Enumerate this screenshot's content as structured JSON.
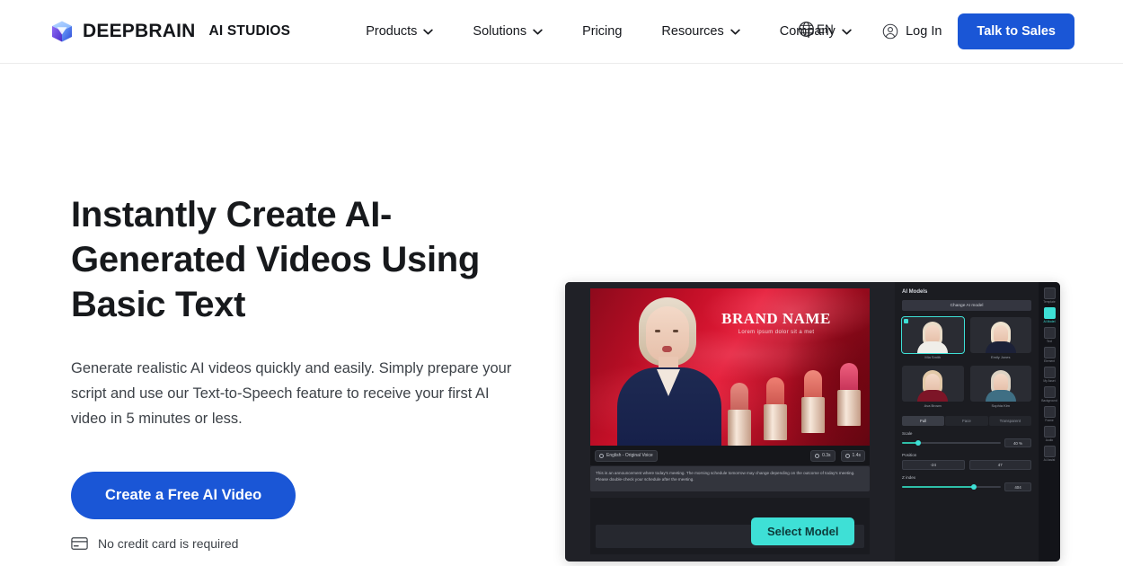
{
  "header": {
    "brand": {
      "name": "DEEPBRAIN",
      "sub": "AI STUDIOS",
      "logo_icon": "cube-icon"
    },
    "nav": [
      {
        "label": "Products",
        "has_dropdown": true
      },
      {
        "label": "Solutions",
        "has_dropdown": true
      },
      {
        "label": "Pricing",
        "has_dropdown": false
      },
      {
        "label": "Resources",
        "has_dropdown": true
      },
      {
        "label": "Company",
        "has_dropdown": true
      }
    ],
    "language": {
      "label": "EN",
      "icon": "globe-icon"
    },
    "login": {
      "label": "Log In",
      "icon": "user-circle-icon"
    },
    "cta": {
      "label": "Talk to Sales"
    }
  },
  "hero": {
    "title": "Instantly Create AI-Generated Videos Using Basic Text",
    "subtitle": "Generate realistic AI videos quickly and easily. Simply prepare your script and use our Text-to-Speech feature to receive your first AI video in 5 minutes or less.",
    "cta_label": "Create a Free AI Video",
    "note": "No credit card is required",
    "note_icon": "credit-card-icon",
    "accent_color": "#1a56d6"
  },
  "editor": {
    "stage": {
      "brand_name": "BRAND NAME",
      "brand_tagline": "Lorem ipsum dolor sit a met"
    },
    "toolbar": {
      "voice_pill": "English - Original Voice",
      "duration_pills": [
        "0.3s",
        "1.4s"
      ]
    },
    "script_text": "This is an announcement where today's meeting. The morning schedule tomorrow may change depending on the outcome of today's meeting. Please double-check your schedule after the meeting.",
    "overlay_button": "Select Model",
    "accent_color": "#3ee0d6",
    "panel": {
      "title": "AI Models",
      "change_button": "Change AI model",
      "models": [
        {
          "name": "Mia Smith",
          "selected": true,
          "hair": "#e9dcc8",
          "body": "#f0eee9"
        },
        {
          "name": "Emily Jones",
          "selected": false,
          "hair": "#efe3cf",
          "body": "#1c2138"
        },
        {
          "name": "Ava Brown",
          "selected": false,
          "hair": "#e2c9a8",
          "body": "#7d1527"
        },
        {
          "name": "Sophia Kim",
          "selected": false,
          "hair": "#ddd3c4",
          "body": "#3f6f84"
        }
      ],
      "tabs": [
        {
          "label": "Full",
          "active": true
        },
        {
          "label": "Face",
          "active": false
        },
        {
          "label": "Transparent",
          "active": false
        }
      ],
      "controls": [
        {
          "label": "Scale",
          "value": "40 %",
          "fill_pct": 16
        },
        {
          "label": "Z index",
          "value": "404",
          "fill_pct": 72
        }
      ],
      "position": {
        "label": "Position",
        "x": "-24",
        "y": "47"
      }
    },
    "rail": [
      {
        "label": "Template",
        "icon": "template-icon",
        "active": false
      },
      {
        "label": "AI Model",
        "icon": "ai-model-icon",
        "active": true
      },
      {
        "label": "Text",
        "icon": "text-icon",
        "active": false
      },
      {
        "label": "Element",
        "icon": "element-icon",
        "active": false
      },
      {
        "label": "My Asset",
        "icon": "my-asset-icon",
        "active": false
      },
      {
        "label": "Background",
        "icon": "background-icon",
        "active": false
      },
      {
        "label": "Frame",
        "icon": "frame-icon",
        "active": false
      },
      {
        "label": "Audio",
        "icon": "audio-icon",
        "active": false
      },
      {
        "label": "AI Assist",
        "icon": "ai-assist-icon",
        "active": false
      }
    ]
  }
}
